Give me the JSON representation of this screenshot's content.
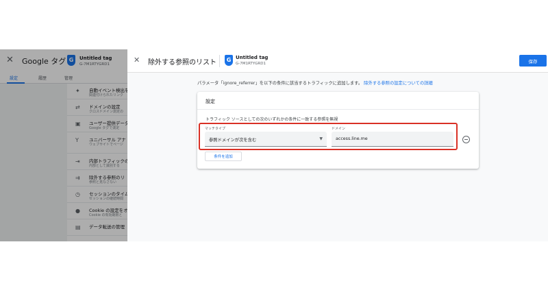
{
  "background": {
    "title": "Google タグ",
    "tag": {
      "name": "Untitled tag",
      "id": "G-7M1RTYGRD1"
    },
    "tabs": [
      {
        "label": "設定"
      },
      {
        "label": "履歴"
      },
      {
        "label": "管理"
      }
    ],
    "items": [
      {
        "icon": "sparkle-icon",
        "title": "自動イベント検出を",
        "desc": "関連付けられたリンク"
      },
      {
        "icon": "cross-domain-icon",
        "title": "ドメインの設定",
        "desc": "クロスドメイン測定の"
      },
      {
        "icon": "user-data-icon",
        "title": "ユーザー提供データ",
        "desc": "Google タグで測定"
      },
      {
        "icon": "universal-icon",
        "title": "ユニバーサル アナ",
        "desc": "ウェブサイトでページ"
      },
      {
        "icon": "internal-traffic-icon",
        "title": "内部トラフィックの",
        "desc": "内部として識別する"
      },
      {
        "icon": "exclude-referral-icon",
        "title": "除外する参照のリ",
        "desc": "参照と見なさない"
      },
      {
        "icon": "session-timeout-icon",
        "title": "セッションのタイム",
        "desc": "セッションの継続時間"
      },
      {
        "icon": "cookie-icon",
        "title": "Cookie の設定をオ",
        "desc": "Cookie の有効期限と"
      },
      {
        "icon": "data-collection-icon",
        "title": "データ転送の管理",
        "desc": ""
      }
    ]
  },
  "panel": {
    "title": "除外する参照のリスト",
    "tag": {
      "name": "Untitled tag",
      "id": "G-7M1RTYGRD1"
    },
    "save_label": "保存",
    "intro_text": "パラメータ「ignore_referrer」を以下の条件に該当するトラフィックに追加します。",
    "intro_link": "除外する参照の設定についての詳細",
    "card": {
      "title": "設定",
      "description": "トラフィック ソースとしての次のいずれかの条件に一致する参照を無視",
      "match_type_label": "マッチタイプ",
      "match_type_value": "参照ドメインが次を含む",
      "domain_label": "ドメイン",
      "domain_value": "access.line.me",
      "add_condition_label": "条件を追加"
    }
  },
  "colors": {
    "accent": "#1a73e8",
    "highlight": "#d93025"
  }
}
